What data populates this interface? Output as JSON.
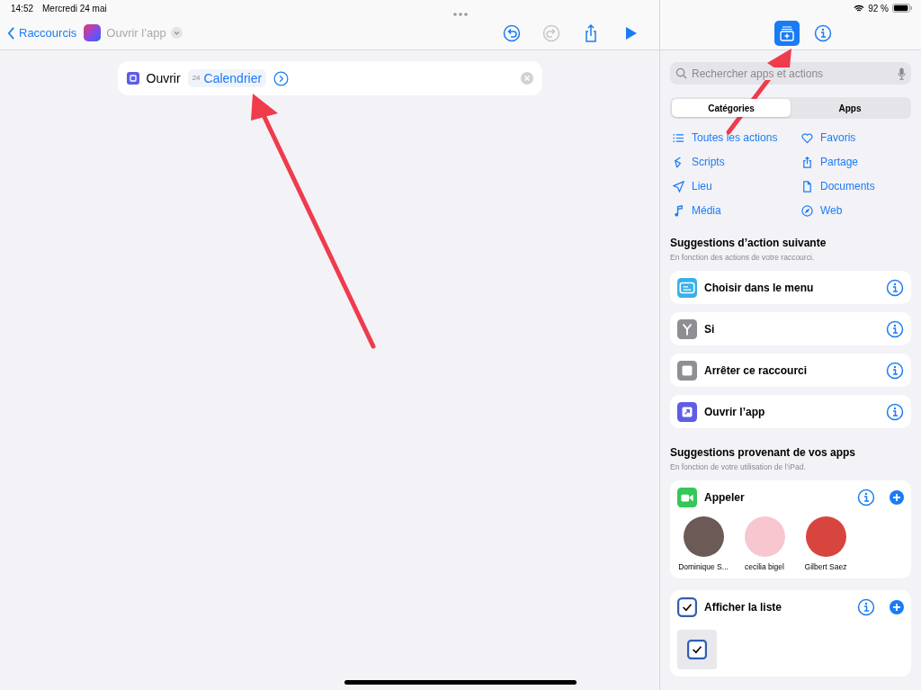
{
  "status_bar": {
    "time": "14:52",
    "date": "Mercredi 24 mai",
    "battery": "92 %"
  },
  "nav": {
    "back": "Raccourcis",
    "title": "Ouvrir l’app"
  },
  "action": {
    "verb": "Ouvrir",
    "app_icon_text": "24",
    "app": "Calendrier"
  },
  "panel": {
    "tabs": [
      {
        "selected": true
      },
      {
        "selected": false
      }
    ],
    "search": {
      "placeholder": "Rechercher apps et actions"
    },
    "segments": [
      {
        "label": "Catégories",
        "selected": true
      },
      {
        "label": "Apps",
        "selected": false
      }
    ],
    "categories": [
      {
        "label": "Toutes les actions"
      },
      {
        "label": "Favoris"
      },
      {
        "label": "Scripts"
      },
      {
        "label": "Partage"
      },
      {
        "label": "Lieu"
      },
      {
        "label": "Documents"
      },
      {
        "label": "Média"
      },
      {
        "label": "Web"
      }
    ],
    "next_suggestions": {
      "title": "Suggestions d’action suivante",
      "subtitle": "En fonction des actions de votre raccourci.",
      "actions": [
        {
          "label": "Choisir dans le menu",
          "color": "#3ab0e8"
        },
        {
          "label": "Si",
          "color": "#8e8e93"
        },
        {
          "label": "Arrêter ce raccourci",
          "color": "#8e8e93"
        },
        {
          "label": "Ouvrir l’app",
          "color": "#5e5ce6"
        }
      ]
    },
    "app_suggestions": {
      "title": "Suggestions provenant de vos apps",
      "subtitle": "En fonction de votre utilisation de l’iPad.",
      "cards": [
        {
          "kind": "contacts",
          "label": "Appeler",
          "color": "#34c759",
          "contacts": [
            {
              "name": "Dominique S...",
              "color": "#6b5a55"
            },
            {
              "name": "cecilia bigel",
              "color": "#f7c6cf"
            },
            {
              "name": "Gilbert Saez",
              "color": "#d8453e"
            }
          ]
        },
        {
          "kind": "preview",
          "label": "Afficher la liste",
          "color": "#2f5fb3"
        }
      ]
    }
  }
}
